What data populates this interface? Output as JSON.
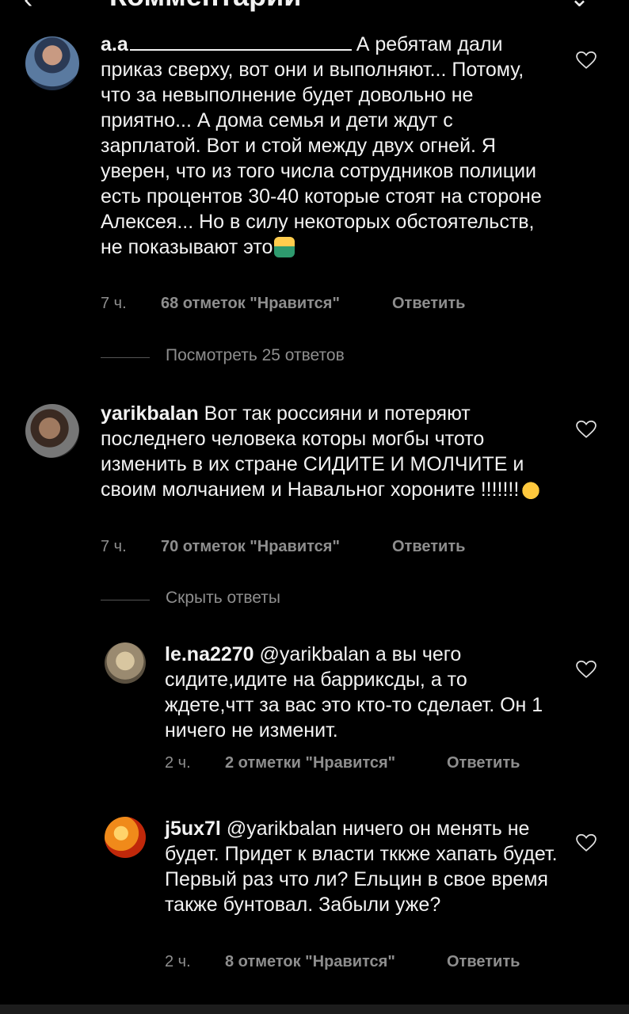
{
  "header": {
    "title": "Комментарии",
    "back_icon": "back-arrow-icon",
    "more_icon": "more-icon"
  },
  "comments": [
    {
      "username": "a.a",
      "text": "А ребятам дали приказ сверху, вот они и выполняют... Потому, что за невыполнение будет довольно не приятно... А дома семья и дети ждут с зарплатой. Вот и стой между двух огней. Я уверен, что из того числа сотрудников полиции есть процентов 30-40 которые стоят на стороне Алексея... Но в силу некоторых обстоятельств, не показывают это",
      "emoji": "person-shrugging",
      "time": "7 ч.",
      "likes": "68 отметок \"Нравится\"",
      "reply": "Ответить"
    },
    {
      "username": "yarikbalan",
      "text": "Вот так россияни и потеряют последнего человека которы могбы чтото изменить в их стране СИДИТЕ И МОЛЧИТЕ  и своим молчанием и Навальног хороните !!!!!!!",
      "emoji": "waving-hand",
      "time": "7 ч.",
      "likes": "70 отметок \"Нравится\"",
      "reply": "Ответить"
    },
    {
      "username": "le.na2270",
      "text": "@yarikbalan а вы чего сидите,идите на барриксды, а то ждете,чтт за вас это кто-то сделает. Он 1 ничего не изменит.",
      "time": "2 ч.",
      "likes": "2 отметки \"Нравится\"",
      "reply": "Ответить"
    },
    {
      "username": "j5ux7l",
      "text": "@yarikbalan ничего он менять не будет. Придет к власти тккже хапать будет. Первый раз что ли? Ельцин в свое время также бунтовал. Забыли уже?",
      "time": "2 ч.",
      "likes": "8 отметок \"Нравится\"",
      "reply": "Ответить"
    }
  ],
  "threads": {
    "view_replies": "Посмотреть 25 ответов",
    "hide_replies": "Скрыть ответы"
  }
}
